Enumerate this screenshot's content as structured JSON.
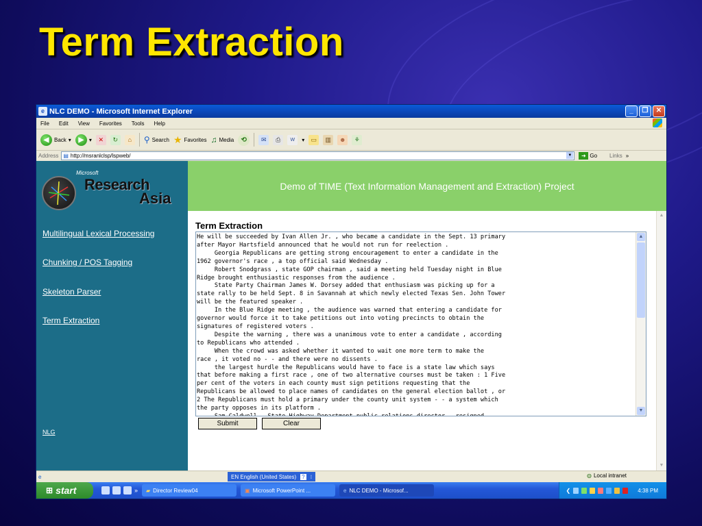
{
  "slide": {
    "title": "Term Extraction"
  },
  "window": {
    "title": "NLC DEMO - Microsoft Internet Explorer"
  },
  "menubar": {
    "items": [
      "File",
      "Edit",
      "View",
      "Favorites",
      "Tools",
      "Help"
    ]
  },
  "toolbar": {
    "back": "Back",
    "search": "Search",
    "favorites": "Favorites",
    "media": "Media"
  },
  "address": {
    "label": "Address",
    "value": "http://msranlclsp/lspweb/",
    "go": "Go",
    "links": "Links"
  },
  "header": {
    "logo_microsoft": "Microsoft",
    "logo_research": "Research",
    "logo_asia": "Asia",
    "banner": "Demo of TIME (Text Information Management and Extraction) Project"
  },
  "sidebar": {
    "links": [
      "Multilingual Lexical Processing",
      "Chunking / POS Tagging",
      "Skeleton Parser",
      "Term Extraction"
    ],
    "bottom_link": "NLG"
  },
  "main": {
    "title": "Term Extraction",
    "text": "He will be succeeded by Ivan Allen Jr. , who became a candidate in the Sept. 13 primary\nafter Mayor Hartsfield announced that he would not run for reelection .\n     Georgia Republicans are getting strong encouragement to enter a candidate in the\n1962 governor's race , a top official said Wednesday .\n     Robert Snodgrass , state GOP chairman , said a meeting held Tuesday night in Blue\nRidge brought enthusiastic responses from the audience .\n     State Party Chairman James W. Dorsey added that enthusiasm was picking up for a\nstate rally to be held Sept. 8 in Savannah at which newly elected Texas Sen. John Tower\nwill be the featured speaker .\n     In the Blue Ridge meeting , the audience was warned that entering a candidate for\ngovernor would force it to take petitions out into voting precincts to obtain the\nsignatures of registered voters .\n     Despite the warning , there was a unanimous vote to enter a candidate , according\nto Republicans who attended .\n     When the crowd was asked whether it wanted to wait one more term to make the\nrace , it voted no - - and there were no dissents .\n     the largest hurdle the Republicans would have to face is a state law which says\nthat before making a first race , one of two alternative courses must be taken : 1 Five\nper cent of the voters in each county must sign petitions requesting that the\nRepublicans be allowed to place names of candidates on the general election ballot , or\n2 The Republicans must hold a primary under the county unit system - - a system which\nthe party opposes in its platform .\n     Sam Caldwell , State Highway Department public relations director , resigned",
    "submit": "Submit",
    "clear": "Clear"
  },
  "statusbar": {
    "language": "EN English (United States)",
    "zone": "Local intranet"
  },
  "taskbar": {
    "start": "start",
    "tasks": [
      "Director Review04",
      "Microsoft PowerPoint ...",
      "NLC DEMO - Microsof..."
    ],
    "clock": "4:38 PM"
  }
}
